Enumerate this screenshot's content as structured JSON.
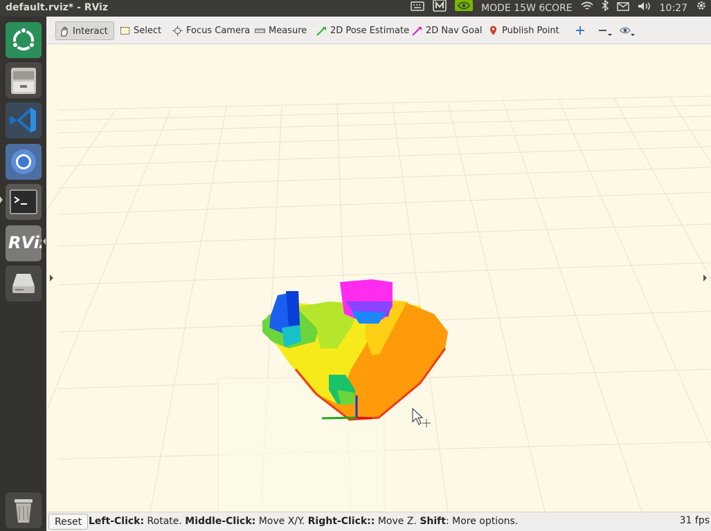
{
  "window": {
    "title": "default.rviz* - RViz"
  },
  "tray": {
    "mode_text": "MODE 15W 6CORE",
    "clock": "10:27",
    "icons": [
      "keyboard-icon",
      "m-indicator-icon",
      "nvidia-icon",
      "wifi-icon",
      "bluetooth-icon",
      "mail-icon",
      "volume-icon",
      "power-gear-icon"
    ]
  },
  "launcher": {
    "items": [
      "ubuntu-dash",
      "files",
      "vscode",
      "chromium",
      "terminal",
      "rviz",
      "drive",
      "trash"
    ]
  },
  "toolbar": {
    "interact": "Interact",
    "select": "Select",
    "focus_camera": "Focus Camera",
    "measure": "Measure",
    "pose_estimate": "2D Pose Estimate",
    "nav_goal": "2D Nav Goal",
    "publish_point": "Publish Point"
  },
  "status": {
    "reset": "Reset",
    "left_click": "Left-Click:",
    "left_action": " Rotate. ",
    "middle_click": "Middle-Click:",
    "middle_action": " Move X/Y. ",
    "right_click": "Right-Click::",
    "right_action": " Move Z. ",
    "shift": "Shift",
    "shift_action": ": More options.",
    "fps": "31 fps"
  },
  "colors": {
    "viewport_bg": "#fdf9e6",
    "grid": "#e7e3cf",
    "accent_orange": "#ff9b10"
  }
}
